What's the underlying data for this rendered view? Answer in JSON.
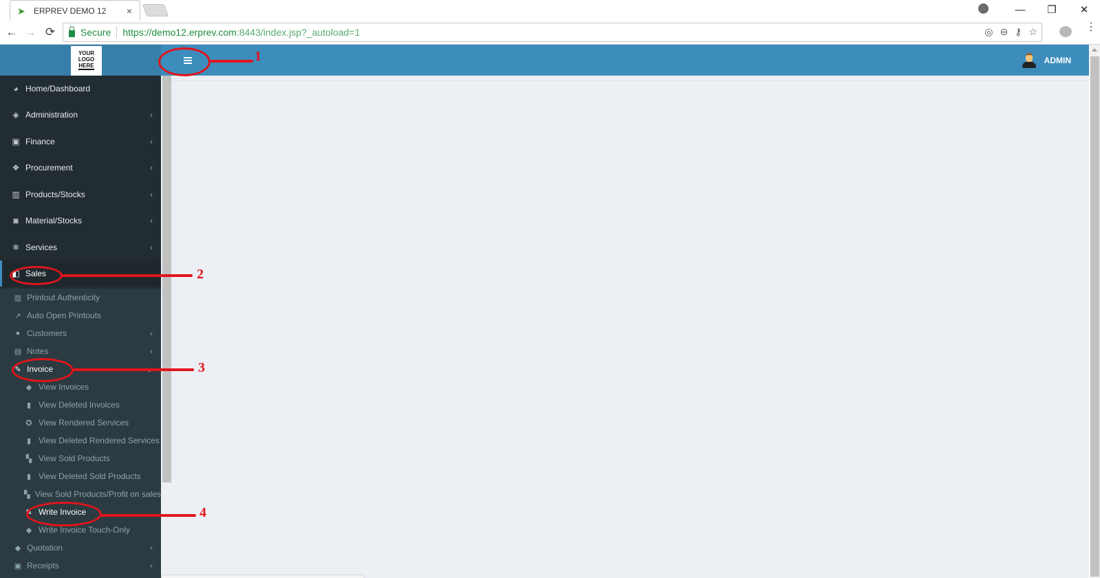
{
  "browser": {
    "tab_title": "ERPREV DEMO 12",
    "tab_close": "×",
    "secure_label": "Secure",
    "url_host": "https://demo12.erprev.com",
    "url_rest": ":8443/index.jsp?_autoload=1",
    "nav": {
      "back": "←",
      "forward": "→",
      "reload": "⟳"
    },
    "window": {
      "minimize": "—",
      "restore": "❐",
      "close": "✕"
    },
    "omnibox_icons": {
      "location": "◎",
      "zoom": "⊖",
      "key": "⚷",
      "star": "☆"
    },
    "menu": "⋮"
  },
  "header": {
    "logo_lines": [
      "YOUR",
      "LOGO",
      "HERE"
    ],
    "user_name": "ADMIN",
    "accent_color": "#3c8dbc"
  },
  "sidebar": {
    "items": [
      {
        "label": "Home/Dashboard",
        "icon": "dashboard-icon",
        "glyph": "◕"
      },
      {
        "label": "Administration",
        "icon": "ticket-icon",
        "glyph": "◈",
        "chev": "‹"
      },
      {
        "label": "Finance",
        "icon": "money-icon",
        "glyph": "▣",
        "chev": "‹"
      },
      {
        "label": "Procurement",
        "icon": "cubes-icon",
        "glyph": "❖",
        "chev": "‹"
      },
      {
        "label": "Products/Stocks",
        "icon": "building-icon",
        "glyph": "▥",
        "chev": "‹"
      },
      {
        "label": "Material/Stocks",
        "icon": "bucket-icon",
        "glyph": "◙",
        "chev": "‹"
      },
      {
        "label": "Services",
        "icon": "snowflake-icon",
        "glyph": "❄",
        "chev": "‹"
      },
      {
        "label": "Sales",
        "icon": "truck-icon",
        "glyph": "◧",
        "chev": "‹"
      }
    ],
    "sales_children": [
      {
        "label": "Printout Authenticity",
        "icon": "barcode-icon",
        "glyph": "▥"
      },
      {
        "label": "Auto Open Printouts",
        "icon": "external-link-icon",
        "glyph": "↗"
      },
      {
        "label": "Customers",
        "icon": "user-icon",
        "glyph": "●",
        "chev": "‹"
      },
      {
        "label": "Notes",
        "icon": "file-text-icon",
        "glyph": "▤",
        "chev": "‹"
      },
      {
        "label": "Invoice",
        "icon": "pencil-icon",
        "glyph": "✎",
        "chev": "⌄"
      }
    ],
    "invoice_children": [
      {
        "label": "View Invoices",
        "icon": "tag-icon",
        "glyph": "◆"
      },
      {
        "label": "View Deleted Invoices",
        "icon": "trash-icon",
        "glyph": "▮"
      },
      {
        "label": "View Rendered Services",
        "icon": "asterisk-circle-icon",
        "glyph": "✪"
      },
      {
        "label": "View Deleted Rendered Services",
        "icon": "trash-icon",
        "glyph": "▮"
      },
      {
        "label": "View Sold Products",
        "icon": "grid-icon",
        "glyph": "▚"
      },
      {
        "label": "View Deleted Sold Products",
        "icon": "trash-icon",
        "glyph": "▮"
      },
      {
        "label": "View Sold Products/Profit on sales",
        "icon": "grid-icon",
        "glyph": "▚"
      },
      {
        "label": "Write Invoice",
        "icon": "pencil-icon",
        "glyph": "✎"
      },
      {
        "label": "Write Invoice Touch-Only",
        "icon": "tag-icon",
        "glyph": "◆"
      }
    ],
    "after_items": [
      {
        "label": "Quotation",
        "icon": "tags-icon",
        "glyph": "◆",
        "chev": "‹"
      },
      {
        "label": "Receipts",
        "icon": "money-icon",
        "glyph": "▣",
        "chev": "‹"
      }
    ]
  },
  "annotations": [
    "1",
    "2",
    "3",
    "4"
  ],
  "annotation_color": "#e3141b"
}
